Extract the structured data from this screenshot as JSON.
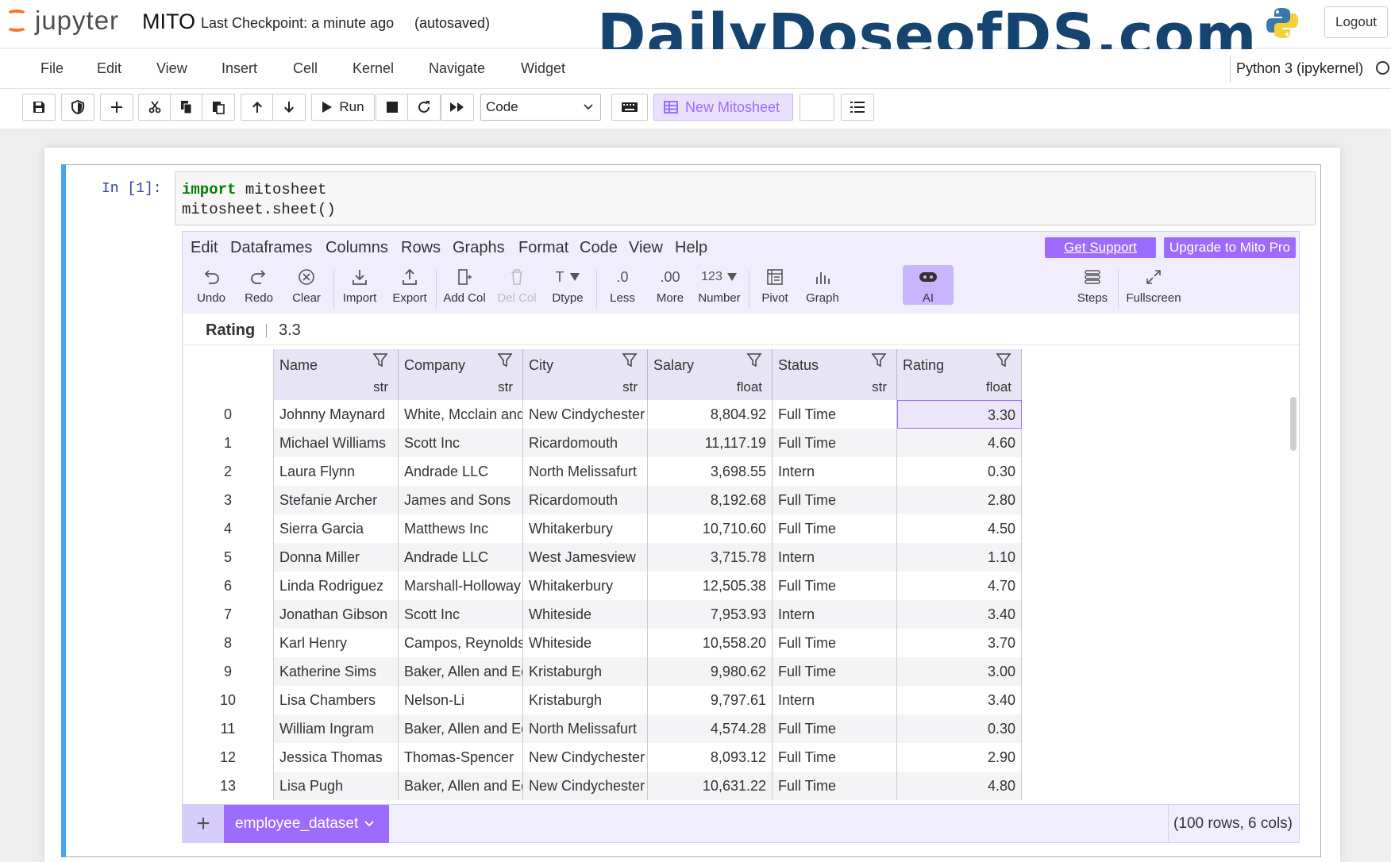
{
  "header": {
    "logo_text": "jupyter",
    "notebook_name": "MITO",
    "checkpoint": "Last Checkpoint: a minute ago",
    "autosave": "(autosaved)",
    "watermark": "DailyDoseofDS.com",
    "logout_label": "Logout"
  },
  "menubar": {
    "items": [
      "File",
      "Edit",
      "View",
      "Insert",
      "Cell",
      "Kernel",
      "Navigate",
      "Widget"
    ],
    "kernel_name": "Python 3 (ipykernel)"
  },
  "toolbar": {
    "run_label": "Run",
    "cell_type": "Code",
    "new_mitosheet_label": "New Mitosheet"
  },
  "cell": {
    "prompt": "In [1]:",
    "code_line1_keyword": "import",
    "code_line1_rest": " mitosheet",
    "code_line2": "mitosheet.sheet()"
  },
  "mito": {
    "menu": [
      "Edit",
      "Dataframes",
      "Columns",
      "Rows",
      "Graphs",
      "Format",
      "Code",
      "View",
      "Help"
    ],
    "get_support": "Get Support",
    "upgrade": "Upgrade to Mito Pro",
    "tools": {
      "undo": "Undo",
      "redo": "Redo",
      "clear": "Clear",
      "import": "Import",
      "export": "Export",
      "add_col": "Add Col",
      "del_col": "Del Col",
      "dtype": "Dtype",
      "less": "Less",
      "more": "More",
      "number": "Number",
      "pivot": "Pivot",
      "graph": "Graph",
      "ai": "AI",
      "steps": "Steps",
      "fullscreen": "Fullscreen",
      "less_glyph": ".0",
      "more_glyph": ".00",
      "number_glyph": "123",
      "dtype_glyph": "T"
    },
    "formula_bar": {
      "column": "Rating",
      "value": "3.3"
    },
    "columns": [
      {
        "name": "Name",
        "dtype": "str"
      },
      {
        "name": "Company",
        "dtype": "str"
      },
      {
        "name": "City",
        "dtype": "str"
      },
      {
        "name": "Salary",
        "dtype": "float"
      },
      {
        "name": "Status",
        "dtype": "str"
      },
      {
        "name": "Rating",
        "dtype": "float"
      }
    ],
    "rows": [
      [
        "0",
        "Johnny Maynard",
        "White, Mcclain and C",
        "New Cindychester",
        "8,804.92",
        "Full Time",
        "3.30"
      ],
      [
        "1",
        "Michael Williams",
        "Scott Inc",
        "Ricardomouth",
        "11,117.19",
        "Full Time",
        "4.60"
      ],
      [
        "2",
        "Laura Flynn",
        "Andrade LLC",
        "North Melissafurt",
        "3,698.55",
        "Intern",
        "0.30"
      ],
      [
        "3",
        "Stefanie Archer",
        "James and Sons",
        "Ricardomouth",
        "8,192.68",
        "Full Time",
        "2.80"
      ],
      [
        "4",
        "Sierra Garcia",
        "Matthews Inc",
        "Whitakerbury",
        "10,710.60",
        "Full Time",
        "4.50"
      ],
      [
        "5",
        "Donna Miller",
        "Andrade LLC",
        "West Jamesview",
        "3,715.78",
        "Intern",
        "1.10"
      ],
      [
        "6",
        "Linda Rodriguez",
        "Marshall-Holloway",
        "Whitakerbury",
        "12,505.38",
        "Full Time",
        "4.70"
      ],
      [
        "7",
        "Jonathan Gibson",
        "Scott Inc",
        "Whiteside",
        "7,953.93",
        "Intern",
        "3.40"
      ],
      [
        "8",
        "Karl Henry",
        "Campos, Reynolds ar",
        "Whiteside",
        "10,558.20",
        "Full Time",
        "3.70"
      ],
      [
        "9",
        "Katherine Sims",
        "Baker, Allen and Edwa",
        "Kristaburgh",
        "9,980.62",
        "Full Time",
        "3.00"
      ],
      [
        "10",
        "Lisa Chambers",
        "Nelson-Li",
        "Kristaburgh",
        "9,797.61",
        "Intern",
        "3.40"
      ],
      [
        "11",
        "William Ingram",
        "Baker, Allen and Edwa",
        "North Melissafurt",
        "4,574.28",
        "Full Time",
        "0.30"
      ],
      [
        "12",
        "Jessica Thomas",
        "Thomas-Spencer",
        "New Cindychester",
        "8,093.12",
        "Full Time",
        "2.90"
      ],
      [
        "13",
        "Lisa Pugh",
        "Baker, Allen and Edwa",
        "New Cindychester",
        "10,631.22",
        "Full Time",
        "4.80"
      ]
    ],
    "selected_cell": {
      "row": 0,
      "column": "Rating"
    },
    "sheet_tab": "employee_dataset",
    "shape": "(100 rows, 6 cols)",
    "accent_color": "#9d6cff"
  }
}
